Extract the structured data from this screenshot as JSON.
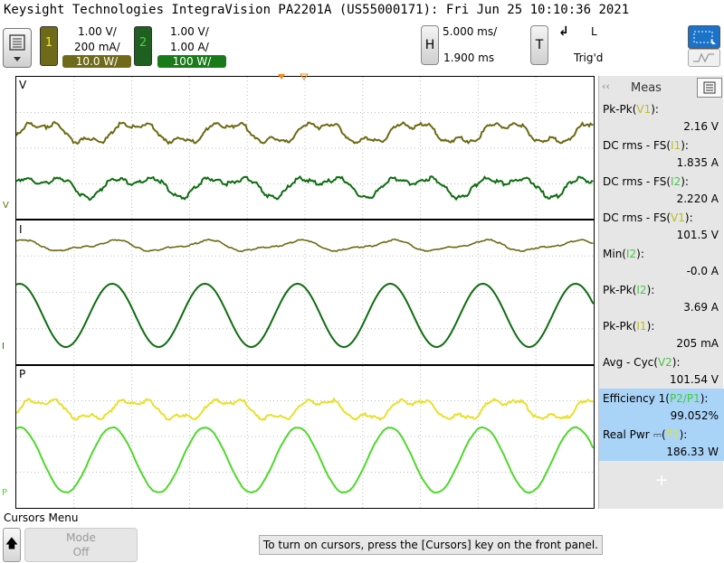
{
  "title": "Keysight Technologies IntegraVision PA2201A (US55000171): Fri Jun 25 10:10:36 2021",
  "ch1": {
    "num": "1",
    "vscale": "1.00 V/",
    "iscale": "200 mA/",
    "pscale": "10.0 W/"
  },
  "ch2": {
    "num": "2",
    "vscale": "1.00 V/",
    "iscale": "1.00 A/",
    "pscale": "100 W/"
  },
  "horizontal": {
    "label": "H",
    "timebase": "5.000 ms/",
    "position": "1.900 ms"
  },
  "trigger": {
    "label": "T",
    "slope": "↲",
    "level": "L",
    "status": "Trig'd"
  },
  "graph": {
    "v": "V",
    "i": "I",
    "p": "P"
  },
  "meas": {
    "title": "Meas",
    "items": [
      {
        "prefix": "Pk-Pk(",
        "src": "V1",
        "suffix": "):",
        "value": "2.16 V",
        "hl": false
      },
      {
        "prefix": "DC rms - FS(",
        "src": "I1",
        "suffix": "):",
        "value": "1.835 A",
        "hl": false
      },
      {
        "prefix": "DC rms - FS(",
        "src": "I2",
        "suffix": "):",
        "value": "2.220 A",
        "hl": false
      },
      {
        "prefix": "DC rms - FS(",
        "src": "V1",
        "suffix": "):",
        "value": "101.5 V",
        "hl": false
      },
      {
        "prefix": "Min(",
        "src": "I2",
        "suffix": "):",
        "value": "-0.0 A",
        "hl": false
      },
      {
        "prefix": "Pk-Pk(",
        "src": "I2",
        "suffix": "):",
        "value": "3.69 A",
        "hl": false
      },
      {
        "prefix": "Pk-Pk(",
        "src": "I1",
        "suffix": "):",
        "value": "205 mA",
        "hl": false
      },
      {
        "prefix": "Avg - Cyc(",
        "src": "V2",
        "suffix": "):",
        "value": "101.54 V",
        "hl": false
      },
      {
        "prefix": "Efficiency 1(",
        "src": "P2/P1",
        "suffix": "):",
        "value": "99.052%",
        "hl": true
      },
      {
        "prefix": "Real Pwr ⎓(",
        "src": "P1",
        "suffix": "):",
        "value": "186.33 W",
        "hl": true
      }
    ],
    "add": "+"
  },
  "bottom": {
    "menu_title": "Cursors Menu",
    "mode_label": "Mode",
    "mode_value": "Off",
    "status": "To turn on cursors, press the [Cursors] key on the front panel."
  }
}
